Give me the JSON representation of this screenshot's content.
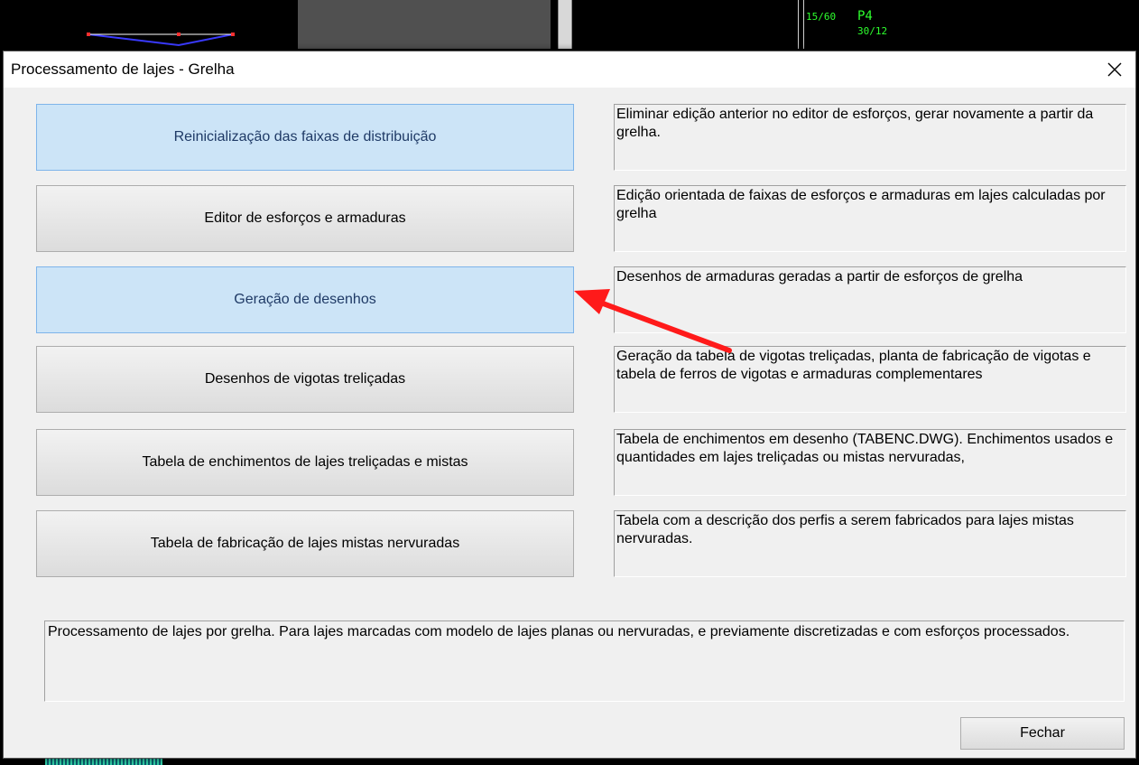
{
  "dialog": {
    "title": "Processamento de lajes - Grelha",
    "close_label": "Fechar"
  },
  "cad_background": {
    "label_1": "15/60",
    "label_2": "P4",
    "label_3": "30/12"
  },
  "buttons": [
    {
      "label": "Reinicialização das faixas de distribuição",
      "highlighted": true,
      "description": "Eliminar edição anterior no editor de esforços, gerar novamente a partir da grelha."
    },
    {
      "label": "Editor de esforços e armaduras",
      "highlighted": false,
      "description": "Edição orientada de faixas de esforços e armaduras em lajes calculadas por grelha"
    },
    {
      "label": "Geração de desenhos",
      "highlighted": true,
      "description": "Desenhos de armaduras geradas a partir de esforços de grelha"
    },
    {
      "label": "Desenhos de vigotas treliçadas",
      "highlighted": false,
      "description": "Geração da tabela de vigotas treliçadas, planta de fabricação de vigotas e tabela de ferros de vigotas e armaduras complementares"
    },
    {
      "label": "Tabela de enchimentos de lajes treliçadas e mistas",
      "highlighted": false,
      "description": "Tabela de enchimentos em desenho (TABENC.DWG). Enchimentos usados e quantidades em lajes treliçadas ou mistas nervuradas,"
    },
    {
      "label": "Tabela de fabricação de lajes mistas nervuradas",
      "highlighted": false,
      "description": "Tabela com a descrição dos perfis a serem fabricados para lajes mistas nervuradas."
    }
  ],
  "status_text": "Processamento de lajes por grelha. Para lajes marcadas com modelo de lajes planas ou nervuradas, e previamente discretizadas e com esforços processados.",
  "annotation": {
    "type": "red-arrow",
    "color": "#ff1a1a",
    "points_to": "Geração de desenhos"
  },
  "colors": {
    "highlight_bg": "#cce4f7",
    "highlight_border": "#7eb4ea",
    "dialog_bg": "#f0f0f0"
  }
}
